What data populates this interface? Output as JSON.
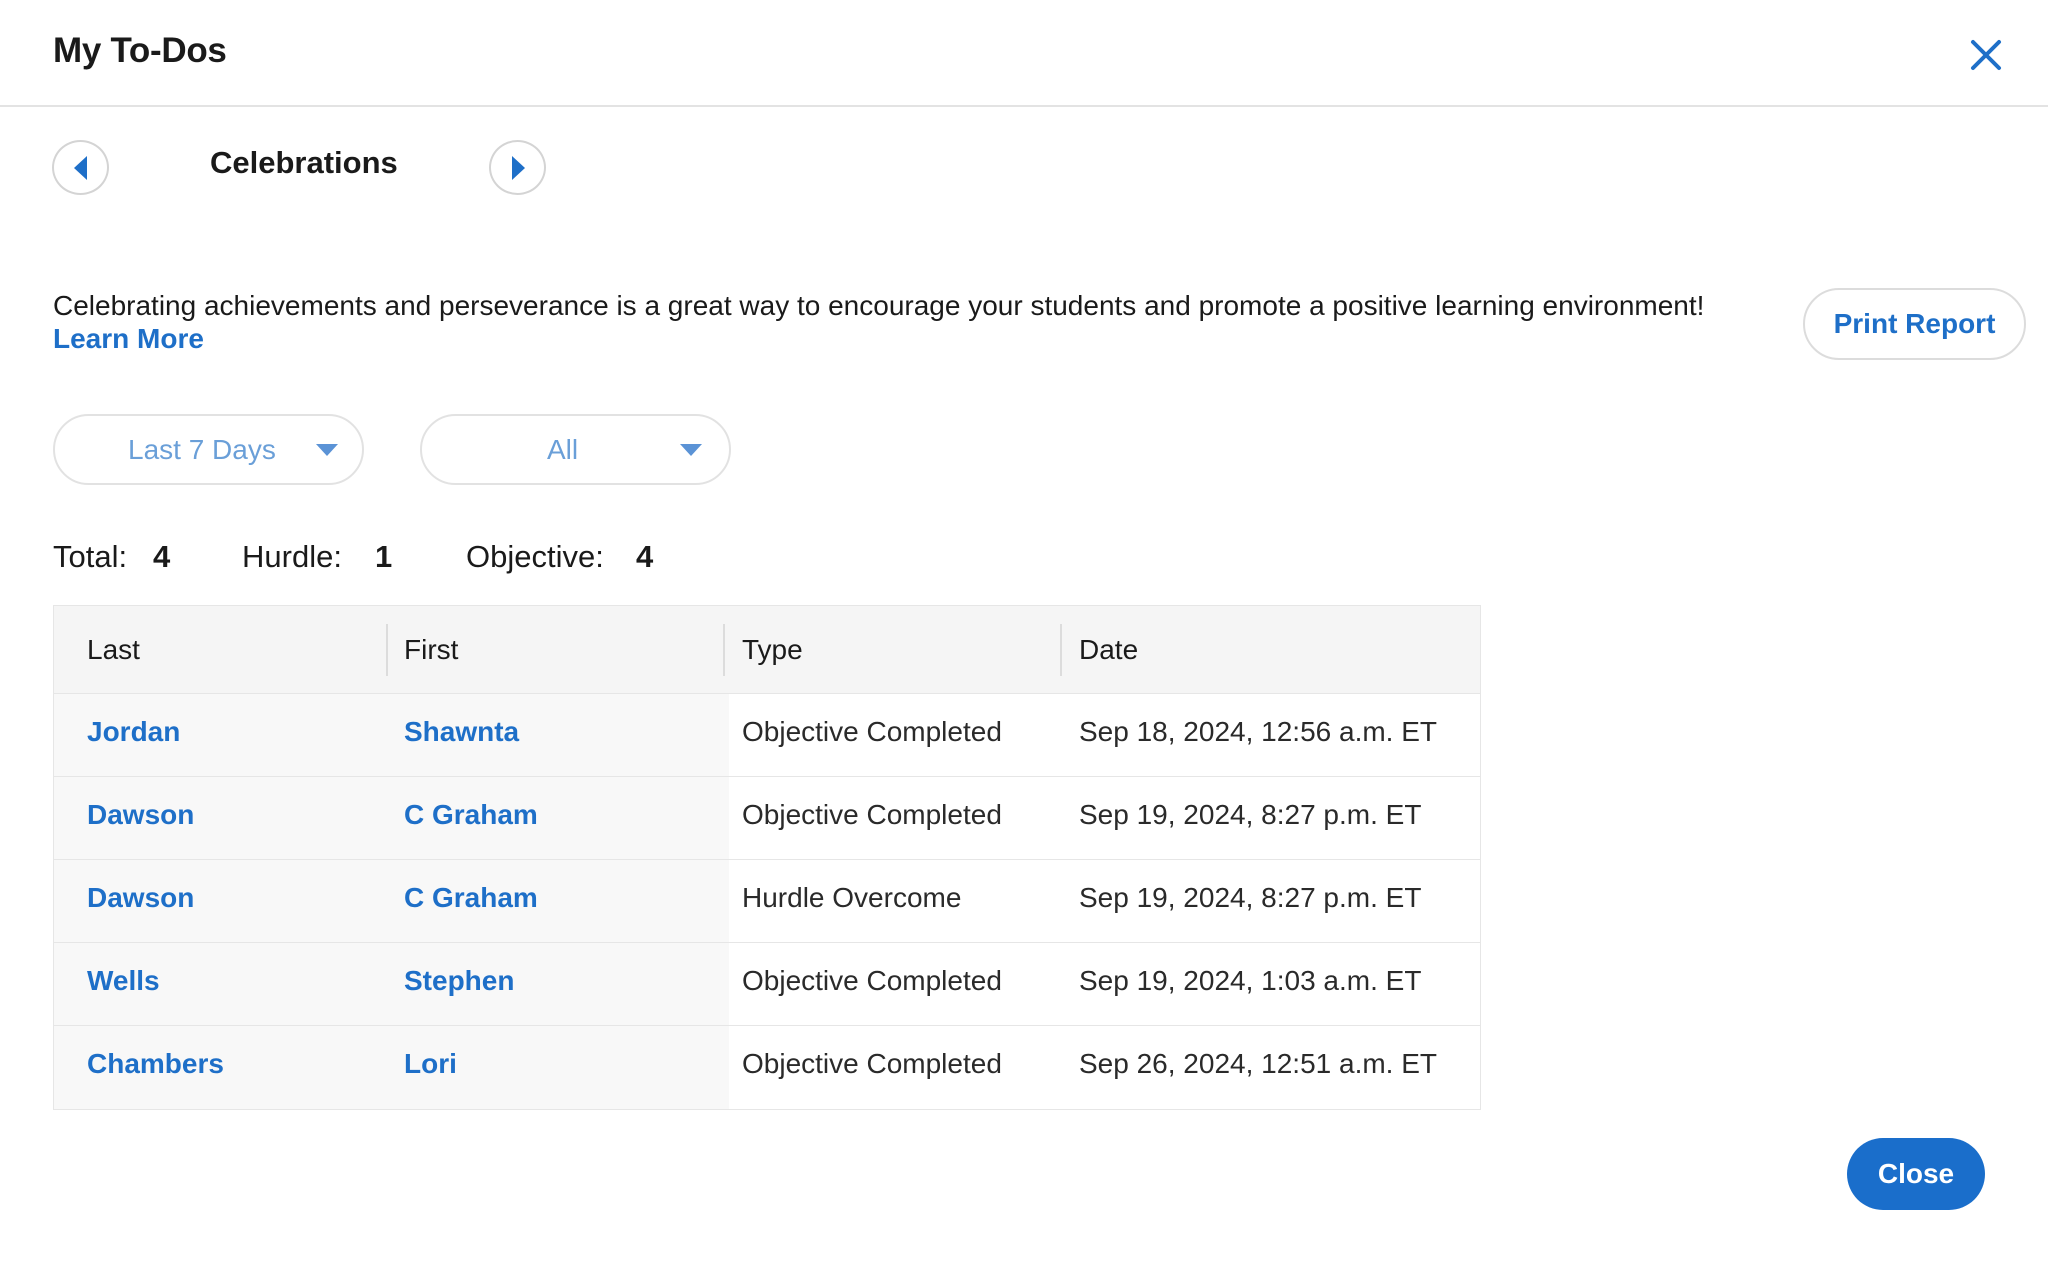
{
  "header": {
    "title": "My To-Dos"
  },
  "section": {
    "title": "Celebrations"
  },
  "description": {
    "text": "Celebrating achievements and perseverance is a great way to encourage your students and promote a positive learning environment!",
    "learn_more": "Learn More"
  },
  "actions": {
    "print_report": "Print Report",
    "close": "Close"
  },
  "filters": {
    "date_range": "Last 7 Days",
    "type": "All"
  },
  "counts": {
    "total_label": "Total:",
    "total": "4",
    "hurdle_label": "Hurdle:",
    "hurdle": "1",
    "objective_label": "Objective:",
    "objective": "4"
  },
  "table": {
    "columns": [
      "Last",
      "First",
      "Type",
      "Date"
    ],
    "rows": [
      {
        "last": "Jordan",
        "first": "Shawnta",
        "type": "Objective Completed",
        "date": "Sep 18, 2024, 12:56 a.m. ET"
      },
      {
        "last": "Dawson",
        "first": "C Graham",
        "type": "Objective Completed",
        "date": "Sep 19, 2024, 8:27 p.m. ET"
      },
      {
        "last": "Dawson",
        "first": "C Graham",
        "type": "Hurdle Overcome",
        "date": "Sep 19, 2024, 8:27 p.m. ET"
      },
      {
        "last": "Wells",
        "first": "Stephen",
        "type": "Objective Completed",
        "date": "Sep 19, 2024, 1:03 a.m. ET"
      },
      {
        "last": "Chambers",
        "first": "Lori",
        "type": "Objective Completed",
        "date": "Sep 26, 2024, 12:51 a.m. ET"
      }
    ]
  },
  "colors": {
    "accent": "#1e6fc8",
    "close_button": "#1a6ecb",
    "filter_text": "#6a9fd8",
    "header_bg": "#f5f5f5"
  },
  "icons": {
    "close": "close-icon",
    "prev": "caret-left-icon",
    "next": "caret-right-icon",
    "dropdown": "caret-down-icon"
  }
}
